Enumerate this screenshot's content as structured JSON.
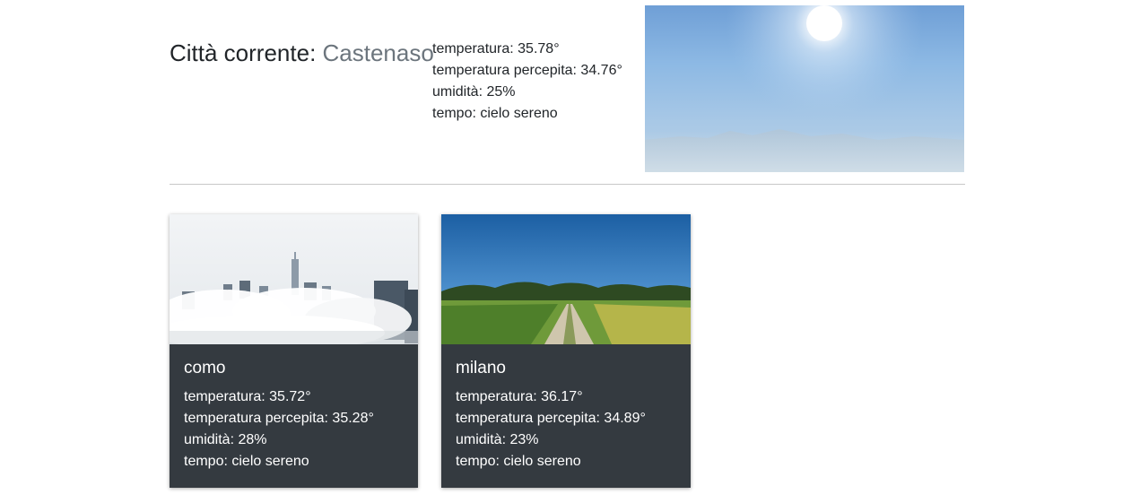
{
  "current": {
    "heading_label": "Città corrente: ",
    "city_name": "Castenaso",
    "temperature": "temperatura: 35.78°",
    "feels_like": "temperatura percepita: 34.76°",
    "humidity": "umidità: 25%",
    "weather": "tempo: cielo sereno",
    "image_icon": "sunny-sky-photo"
  },
  "cities": [
    {
      "name": "como",
      "temperature": "temperatura: 35.72°",
      "feels_like": "temperatura percepita: 35.28°",
      "humidity": "umidità: 28%",
      "weather": "tempo: cielo sereno",
      "image_icon": "city-in-clouds-photo"
    },
    {
      "name": "milano",
      "temperature": "temperatura: 36.17°",
      "feels_like": "temperatura percepita: 34.89°",
      "humidity": "umidità: 23%",
      "weather": "tempo: cielo sereno",
      "image_icon": "countryside-road-photo"
    }
  ],
  "colors": {
    "card_background": "#343a40",
    "muted_text": "#6c757d",
    "divider": "#c8c8c8"
  }
}
